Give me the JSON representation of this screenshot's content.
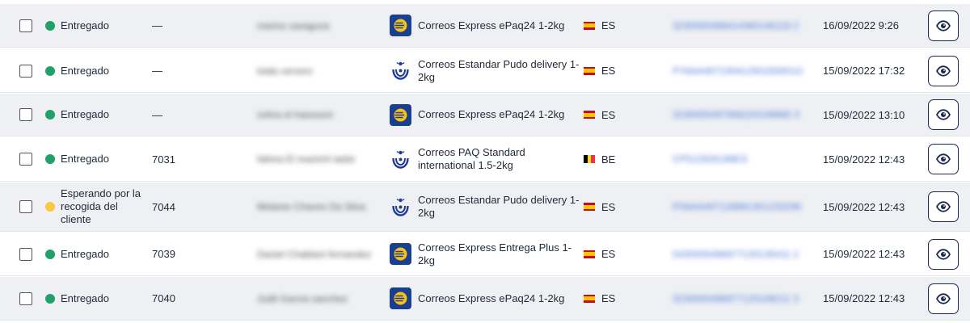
{
  "rows": [
    {
      "status": "Entregado",
      "status_color": "#22a06b",
      "ref": "—",
      "name": "marino zaragoza",
      "carrier": "Correos Express ePaq24 1-2kg",
      "carrier_logo": "correos-express-logo",
      "country": "ES",
      "flag": "es",
      "tracking": "3230005498414360146118 2",
      "date": "16/09/2022 9:26"
    },
    {
      "status": "Entregado",
      "status_color": "#22a06b",
      "ref": "—",
      "name": "loida cervero",
      "carrier": "Correos Estandar Pudo delivery 1-2kg",
      "carrier_logo": "correos-logo",
      "country": "ES",
      "flag": "es",
      "tracking": "PY6AA40710041250150001G",
      "date": "15/09/2022 17:32"
    },
    {
      "status": "Entregado",
      "status_color": "#22a06b",
      "ref": "—",
      "name": "zohra el hassouni",
      "carrier": "Correos Express ePaq24 1-2kg",
      "carrier_logo": "correos-express-logo",
      "country": "ES",
      "flag": "es",
      "tracking": "3230005497068220108980 3",
      "date": "15/09/2022 13:10"
    },
    {
      "status": "Entregado",
      "status_color": "#22a06b",
      "ref": "7031",
      "name": "fatima El manichi tadst",
      "carrier": "Correos PAQ Standard international 1.5-2kg",
      "carrier_logo": "correos-logo",
      "country": "BE",
      "flag": "be",
      "tracking": "CP512926198ES",
      "date": "15/09/2022 12:43"
    },
    {
      "status": "Esperando por la recogida del cliente",
      "status_color": "#f7c948",
      "ref": "7044",
      "name": "Melanie Chaves Da Silva",
      "carrier": "Correos Estandar Pudo delivery 1-2kg",
      "carrier_logo": "correos-logo",
      "country": "ES",
      "flag": "es",
      "tracking": "PS6AA40712889130123320K",
      "date": "15/09/2022 12:43"
    },
    {
      "status": "Entregado",
      "status_color": "#22a06b",
      "ref": "7039",
      "name": "Daniel Chablani fernandez",
      "carrier": "Correos Express Entrega Plus 1-2kg",
      "carrier_logo": "correos-express-logo",
      "country": "ES",
      "flag": "es",
      "tracking": "5430005496977130135411 2",
      "date": "15/09/2022 12:43"
    },
    {
      "status": "Entregado",
      "status_color": "#22a06b",
      "ref": "7040",
      "name": "Judit Garcia sanchez",
      "carrier": "Correos Express ePaq24 1-2kg",
      "carrier_logo": "correos-express-logo",
      "country": "ES",
      "flag": "es",
      "tracking": "3230005496977120108211 3",
      "date": "15/09/2022 12:43"
    }
  ],
  "icons": {
    "view": "eye-icon",
    "checkbox": "checkbox"
  },
  "colors": {
    "accent": "#1b2a4e",
    "link": "#4a78d6",
    "alt_row": "#eef0f4",
    "correos_express_bg": "#1a3f8f",
    "correos_express_fg": "#f7c01a",
    "correos_blue": "#1f3a93"
  }
}
